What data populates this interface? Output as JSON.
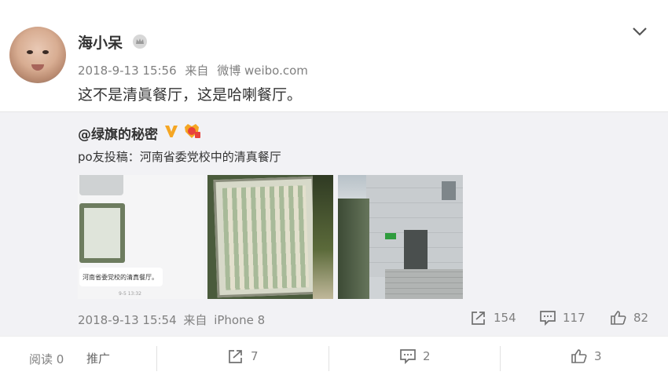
{
  "post": {
    "user_name": "海小呆",
    "time": "2018-9-13 15:56",
    "source_prefix": "来自",
    "source": "微博 weibo.com",
    "text": "这不是清眞餐厅，这是哈喇餐厅。"
  },
  "repost": {
    "author": "@绿旗的秘密",
    "text": "po友投稿：河南省委党校中的清真餐厅",
    "image_caption": "河南省委党校的清真餐厅。",
    "image_time": "9-5 13:32",
    "time": "2018-9-13 15:54",
    "source_prefix": "来自",
    "source": "iPhone 8",
    "forward_count": "154",
    "comment_count": "117",
    "like_count": "82"
  },
  "footer": {
    "read_label": "阅读 0",
    "promote_label": "推广",
    "forward_count": "7",
    "comment_count": "2",
    "like_count": "3"
  },
  "colors": {
    "text": "#333333",
    "meta": "#808080",
    "repost_bg": "#f2f2f5",
    "verified_gold": "#f5a623"
  },
  "icons": [
    "crown-icon",
    "chevron-down-icon",
    "verified-v-icon",
    "member-badge-icon",
    "forward-icon",
    "comment-icon",
    "like-icon"
  ]
}
